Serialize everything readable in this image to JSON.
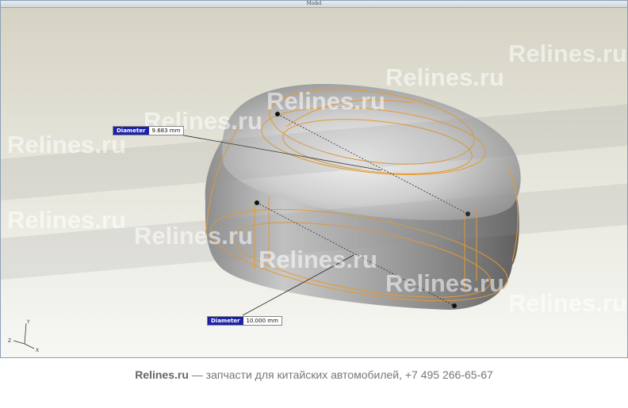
{
  "window": {
    "title": "Model"
  },
  "watermark": {
    "text": "Relines.ru"
  },
  "dimensions": [
    {
      "name": "Diameter",
      "value": "9.683 mm"
    },
    {
      "name": "Diameter",
      "value": "10.000 mm"
    }
  ],
  "axes": {
    "y": "Y",
    "z": "Z",
    "x": "X"
  },
  "footer": {
    "brand": "Relines.ru",
    "text": " — запчасти для китайских автомобилей, +7 495 266-65-67"
  },
  "colors": {
    "wireframe": "#e59a30",
    "dimension_key_bg": "#1c22a8",
    "model_surface": "#b9b9b9"
  }
}
